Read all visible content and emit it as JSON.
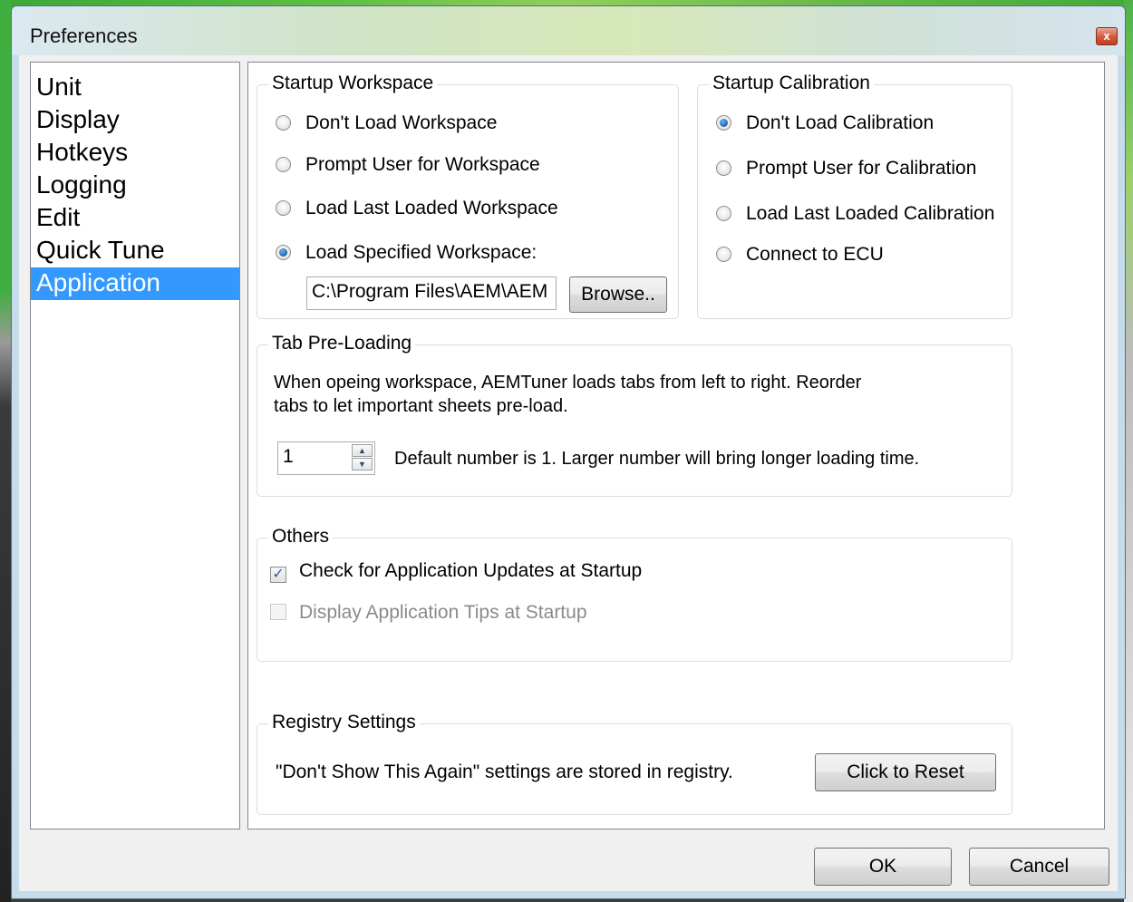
{
  "window": {
    "title": "Preferences",
    "close_glyph": "x"
  },
  "nav": {
    "items": [
      {
        "label": "Unit"
      },
      {
        "label": "Display"
      },
      {
        "label": "Hotkeys"
      },
      {
        "label": "Logging"
      },
      {
        "label": "Edit"
      },
      {
        "label": "Quick Tune"
      },
      {
        "label": "Application",
        "selected": true
      }
    ]
  },
  "startup_workspace": {
    "label": "Startup Workspace",
    "options": [
      "Don't Load Workspace",
      "Prompt User for Workspace",
      "Load Last Loaded Workspace",
      "Load Specified Workspace:"
    ],
    "selected_index": 3,
    "path_value": "C:\\Program Files\\AEM\\AEM",
    "browse_label": "Browse.."
  },
  "startup_calibration": {
    "label": "Startup Calibration",
    "options": [
      "Don't Load Calibration",
      "Prompt User for Calibration",
      "Load Last Loaded Calibration",
      "Connect to ECU"
    ],
    "selected_index": 0
  },
  "tab_preloading": {
    "label": "Tab Pre-Loading",
    "description_line1": "When opeing workspace, AEMTuner loads tabs from left to right. Reorder",
    "description_line2": "tabs to let important sheets pre-load.",
    "count_value": "1",
    "hint": "Default number is 1. Larger number will bring longer loading time."
  },
  "others": {
    "label": "Others",
    "check_updates_label": "Check for Application Updates at Startup",
    "check_updates_checked": true,
    "tips_label": "Display Application Tips at Startup",
    "tips_checked": false,
    "tips_enabled": false
  },
  "registry": {
    "label": "Registry Settings",
    "text": "\"Don't Show This Again\" settings are stored  in registry.",
    "reset_label": "Click to Reset"
  },
  "footer": {
    "ok_label": "OK",
    "cancel_label": "Cancel"
  }
}
